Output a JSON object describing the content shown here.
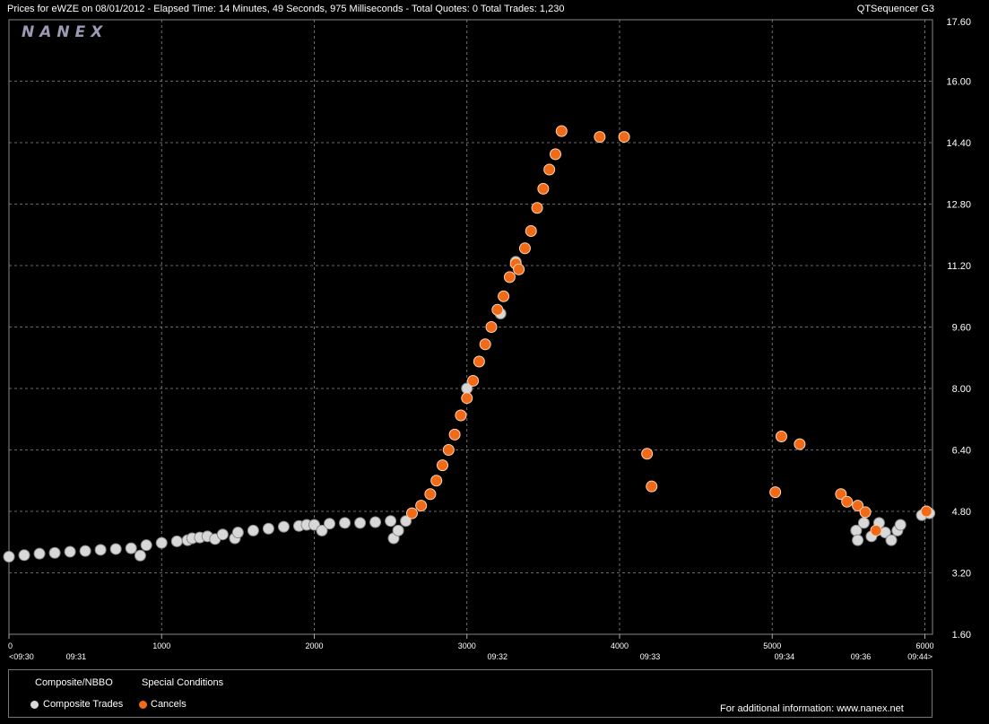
{
  "header": {
    "title": "Prices for  eWZE  on  08/01/2012  -  Elapsed Time: 14 Minutes, 49 Seconds, 975 Milliseconds  -  Total Quotes: 0  Total Trades: 1,230",
    "app": "QTSequencer G3"
  },
  "logo": {
    "text": "NANEX"
  },
  "legend": {
    "group1": "Composite/NBBO",
    "group2": "Special Conditions",
    "item1": "Composite Trades",
    "item2": "Cancels",
    "footer": "For additional information: www.nanex.net"
  },
  "colors": {
    "background": "#000000",
    "grid": "#8c8c8c",
    "composite": "#d8d8d8",
    "cancels": "#f06a18"
  },
  "chart_data": {
    "type": "scatter",
    "title": "Prices for  eWZE  on  08/01/2012",
    "xlim": [
      0,
      6050
    ],
    "ylim": [
      1.6,
      17.6
    ],
    "y_ticks": [
      "17.60",
      "16.00",
      "14.40",
      "12.80",
      "11.20",
      "9.60",
      "8.00",
      "6.40",
      "4.80",
      "3.20",
      "1.60"
    ],
    "x_ticks": [
      0,
      1000,
      2000,
      3000,
      4000,
      5000,
      6000
    ],
    "time_labels": [
      {
        "x": 0,
        "label": "<09:30"
      },
      {
        "x": 440,
        "label": "09:31"
      },
      {
        "x": 3200,
        "label": "09:32"
      },
      {
        "x": 4200,
        "label": "09:33"
      },
      {
        "x": 5080,
        "label": "09:34"
      },
      {
        "x": 5580,
        "label": "09:36"
      },
      {
        "x": 6050,
        "label": "09:44>"
      }
    ],
    "composite_trades": [
      [
        0,
        3.62
      ],
      [
        100,
        3.66
      ],
      [
        200,
        3.7
      ],
      [
        300,
        3.72
      ],
      [
        400,
        3.75
      ],
      [
        500,
        3.77
      ],
      [
        600,
        3.8
      ],
      [
        700,
        3.82
      ],
      [
        800,
        3.84
      ],
      [
        860,
        3.65
      ],
      [
        900,
        3.92
      ],
      [
        1000,
        3.98
      ],
      [
        1100,
        4.02
      ],
      [
        1170,
        4.05
      ],
      [
        1200,
        4.1
      ],
      [
        1250,
        4.12
      ],
      [
        1300,
        4.15
      ],
      [
        1350,
        4.08
      ],
      [
        1400,
        4.2
      ],
      [
        1480,
        4.1
      ],
      [
        1500,
        4.25
      ],
      [
        1600,
        4.3
      ],
      [
        1700,
        4.35
      ],
      [
        1800,
        4.4
      ],
      [
        1900,
        4.42
      ],
      [
        1950,
        4.45
      ],
      [
        2000,
        4.45
      ],
      [
        2050,
        4.3
      ],
      [
        2100,
        4.48
      ],
      [
        2200,
        4.5
      ],
      [
        2300,
        4.5
      ],
      [
        2400,
        4.52
      ],
      [
        2500,
        4.55
      ],
      [
        2520,
        4.1
      ],
      [
        2550,
        4.3
      ],
      [
        2600,
        4.55
      ],
      [
        3000,
        8.0
      ],
      [
        3220,
        9.95
      ],
      [
        3320,
        11.3
      ],
      [
        5550,
        4.3
      ],
      [
        5560,
        4.05
      ],
      [
        5600,
        4.5
      ],
      [
        5650,
        4.15
      ],
      [
        5700,
        4.5
      ],
      [
        5740,
        4.25
      ],
      [
        5780,
        4.05
      ],
      [
        5820,
        4.3
      ],
      [
        5840,
        4.45
      ],
      [
        5980,
        4.7
      ],
      [
        6030,
        4.75
      ]
    ],
    "cancels": [
      [
        2640,
        4.75
      ],
      [
        2700,
        4.95
      ],
      [
        2760,
        5.25
      ],
      [
        2800,
        5.6
      ],
      [
        2840,
        6.0
      ],
      [
        2880,
        6.4
      ],
      [
        2920,
        6.8
      ],
      [
        2960,
        7.3
      ],
      [
        3000,
        7.75
      ],
      [
        3040,
        8.2
      ],
      [
        3080,
        8.7
      ],
      [
        3120,
        9.15
      ],
      [
        3160,
        9.6
      ],
      [
        3200,
        10.05
      ],
      [
        3240,
        10.4
      ],
      [
        3280,
        10.9
      ],
      [
        3320,
        11.25
      ],
      [
        3340,
        11.1
      ],
      [
        3380,
        11.65
      ],
      [
        3420,
        12.1
      ],
      [
        3460,
        12.7
      ],
      [
        3500,
        13.2
      ],
      [
        3540,
        13.7
      ],
      [
        3580,
        14.1
      ],
      [
        3620,
        14.7
      ],
      [
        3870,
        14.55
      ],
      [
        4030,
        14.55
      ],
      [
        4180,
        6.3
      ],
      [
        4210,
        5.45
      ],
      [
        5020,
        5.3
      ],
      [
        5060,
        6.75
      ],
      [
        5180,
        6.55
      ],
      [
        5450,
        5.25
      ],
      [
        5490,
        5.05
      ],
      [
        5560,
        4.95
      ],
      [
        5610,
        4.78
      ],
      [
        5680,
        4.3
      ],
      [
        6010,
        4.8
      ]
    ]
  }
}
